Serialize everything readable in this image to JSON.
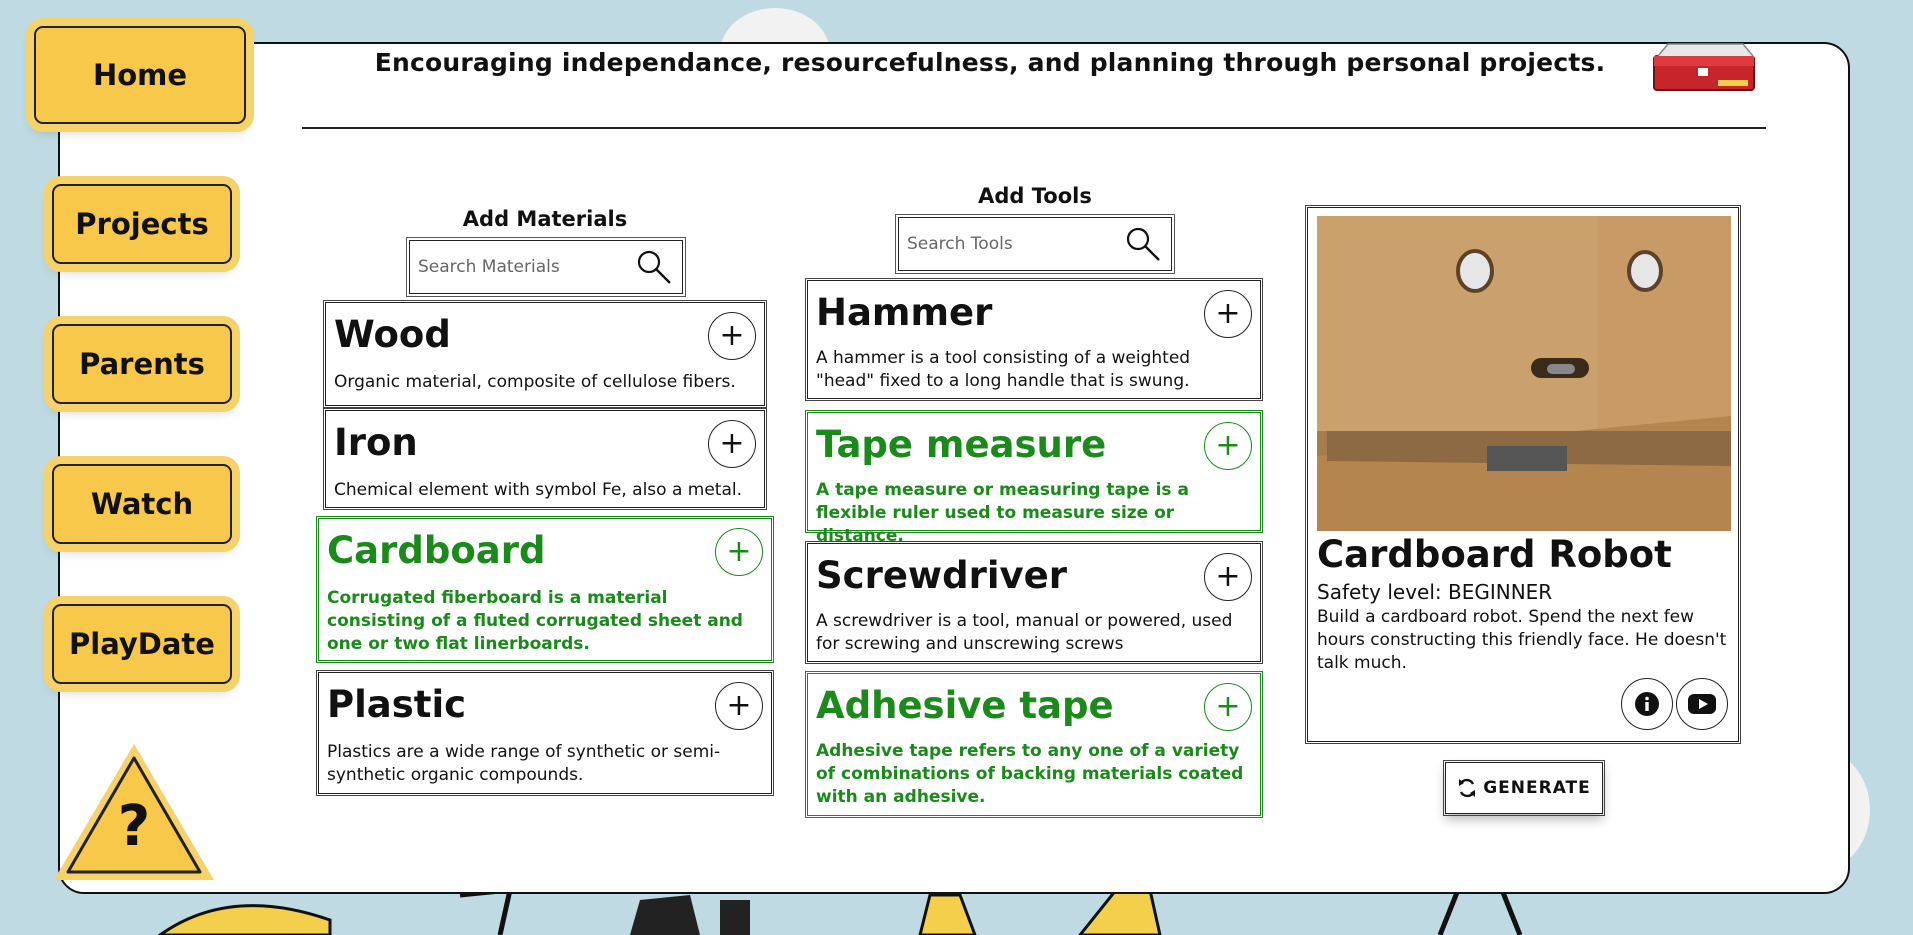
{
  "header": {
    "tagline": "Encouraging independance, resourcefulness, and planning through personal projects."
  },
  "nav": {
    "home": "Home",
    "projects": "Projects",
    "parents": "Parents",
    "watch": "Watch",
    "playdate": "PlayDate",
    "help": "?"
  },
  "materials": {
    "title": "Add Materials",
    "search_placeholder": "Search Materials",
    "items": [
      {
        "name": "Wood",
        "desc": "Organic material, composite of cellulose fibers.",
        "selected": false
      },
      {
        "name": "Iron",
        "desc": "Chemical element with symbol Fe, also a metal.",
        "selected": false
      },
      {
        "name": "Cardboard",
        "desc": "Corrugated fiberboard is a material consisting of a fluted corrugated sheet and one or two flat linerboards.",
        "selected": true
      },
      {
        "name": "Plastic",
        "desc": "Plastics are a wide range of synthetic or semi-synthetic organic compounds.",
        "selected": false
      }
    ]
  },
  "tools": {
    "title": "Add Tools",
    "search_placeholder": "Search Tools",
    "items": [
      {
        "name": "Hammer",
        "desc": "A hammer is a tool consisting of a weighted \"head\" fixed to a long handle that is swung.",
        "selected": false
      },
      {
        "name": "Tape measure",
        "desc": "A tape measure or measuring tape is a flexible ruler used to measure size or distance.",
        "selected": true
      },
      {
        "name": "Screwdriver",
        "desc": "A screwdriver is a tool, manual or powered, used for screwing and unscrewing screws",
        "selected": false
      },
      {
        "name": "Adhesive tape",
        "desc": "Adhesive tape refers to any one of a variety of combinations of backing materials coated with an adhesive.",
        "selected": true
      }
    ]
  },
  "project": {
    "title": "Cardboard Robot",
    "safety": "Safety level: BEGINNER",
    "desc": "Build a cardboard robot. Spend the next few hours constructing this friendly face. He doesn't talk much.",
    "info_icon": "info-icon",
    "video_icon": "youtube-icon"
  },
  "generate": {
    "label": "GENERATE",
    "icon": "refresh-icon"
  },
  "colors": {
    "accent_yellow": "#f8c84a",
    "selected_green": "#1a8a1a",
    "background": "#bfdae2"
  }
}
